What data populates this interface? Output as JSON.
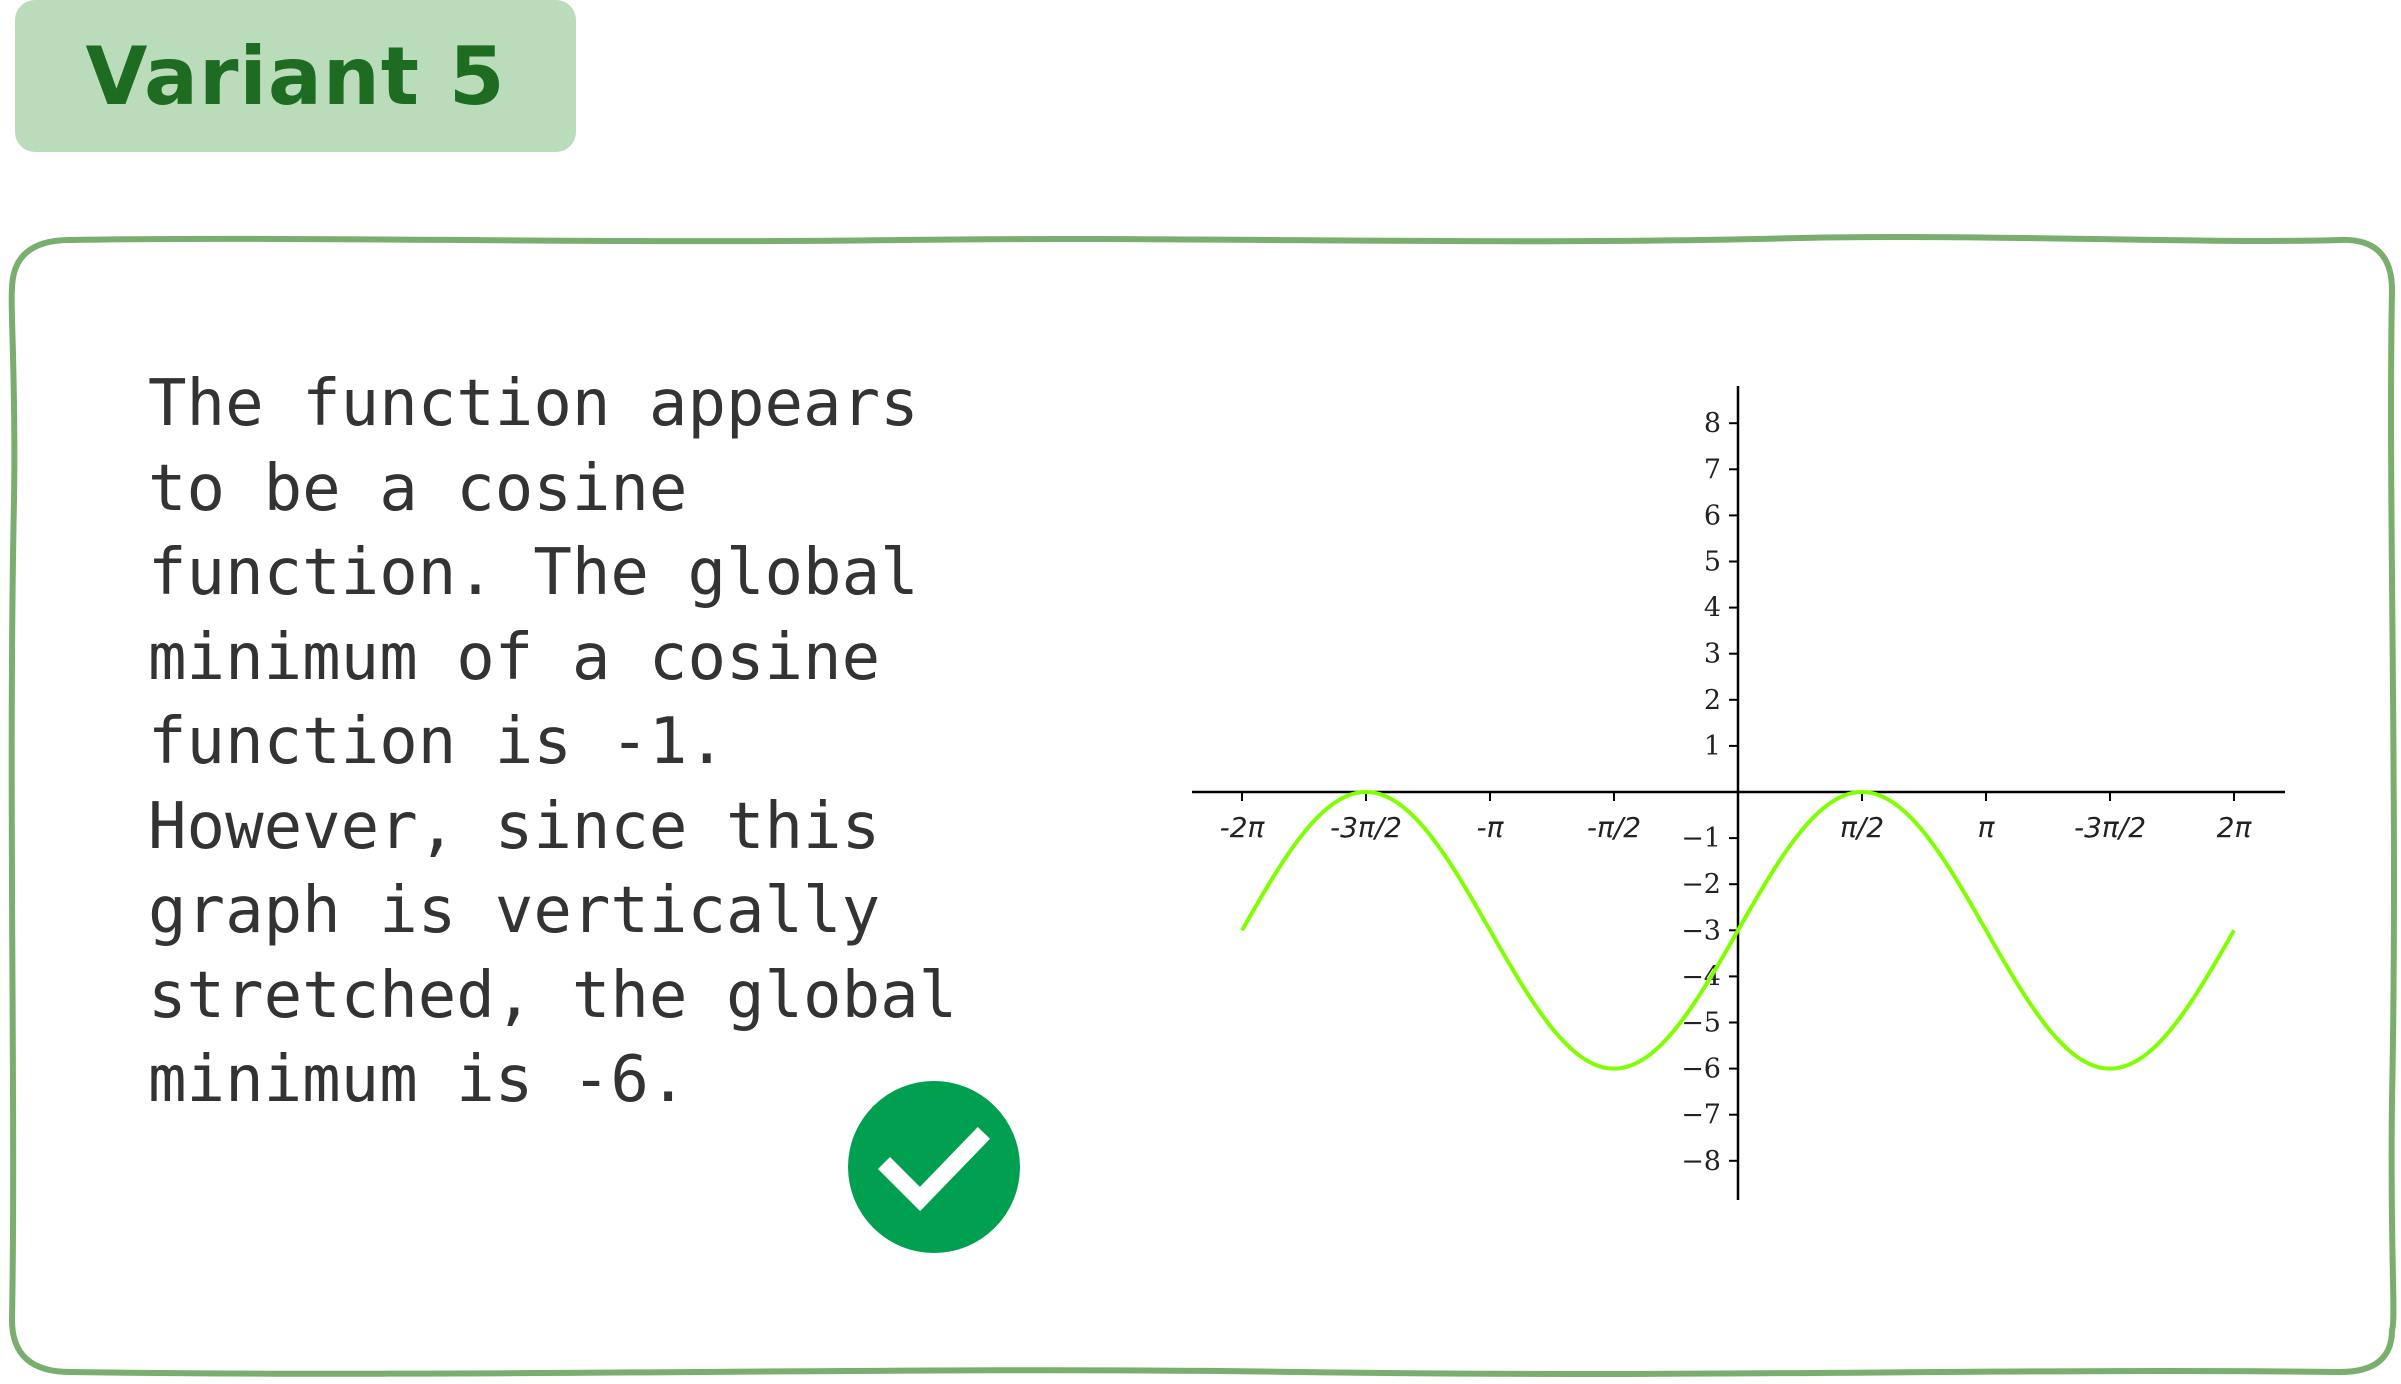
{
  "header": {
    "variant_label": "Variant 5"
  },
  "explanation": {
    "text": "The function appears\nto be a cosine\nfunction. The global\nminimum of a cosine\nfunction is -1.\nHowever, since this\ngraph is vertically\nstretched, the global\nminimum is -6."
  },
  "status": {
    "icon": "check-icon",
    "color": "#00a050"
  },
  "colors": {
    "tag_background": "#badcbb",
    "tag_text": "#1e6b22",
    "border": "#7aae6e",
    "curve": "#7fff00"
  },
  "chart_data": {
    "type": "line",
    "title": "",
    "xlabel": "",
    "ylabel": "",
    "xlim": [
      -6.2832,
      6.2832
    ],
    "ylim": [
      -8,
      8
    ],
    "grid": false,
    "x_ticks": [
      {
        "value": -6.2832,
        "label": "-2π"
      },
      {
        "value": -4.7124,
        "label": "-3π/2"
      },
      {
        "value": -3.1416,
        "label": "-π"
      },
      {
        "value": -1.5708,
        "label": "-π/2"
      },
      {
        "value": 1.5708,
        "label": "π/2"
      },
      {
        "value": 3.1416,
        "label": "π"
      },
      {
        "value": 4.7124,
        "label": "-3π/2"
      },
      {
        "value": 6.2832,
        "label": "2π"
      }
    ],
    "y_ticks": [
      {
        "value": 8,
        "label": "8"
      },
      {
        "value": 7,
        "label": "7"
      },
      {
        "value": 6,
        "label": "6"
      },
      {
        "value": 5,
        "label": "5"
      },
      {
        "value": 4,
        "label": "4"
      },
      {
        "value": 3,
        "label": "3"
      },
      {
        "value": 2,
        "label": "2"
      },
      {
        "value": 1,
        "label": "1"
      },
      {
        "value": -1,
        "label": "−1"
      },
      {
        "value": -2,
        "label": "−2"
      },
      {
        "value": -3,
        "label": "−3"
      },
      {
        "value": -4,
        "label": "−4"
      },
      {
        "value": -5,
        "label": "−5"
      },
      {
        "value": -6,
        "label": "−6"
      },
      {
        "value": -7,
        "label": "−7"
      },
      {
        "value": -8,
        "label": "−8"
      }
    ],
    "series": [
      {
        "function": "3*cos(x - π/2) - 3",
        "x": [
          -6.2832,
          -5.4978,
          -4.7124,
          -3.927,
          -3.1416,
          -2.3562,
          -1.5708,
          -0.7854,
          0,
          0.7854,
          1.5708,
          2.3562,
          3.1416,
          3.927,
          4.7124,
          5.4978,
          6.2832
        ],
        "y": [
          -3,
          -0.879,
          0,
          -0.879,
          -3,
          -5.121,
          -6,
          -5.121,
          -3,
          -0.879,
          0,
          -0.879,
          -3,
          -5.121,
          -6,
          -5.121,
          -3
        ]
      }
    ]
  }
}
